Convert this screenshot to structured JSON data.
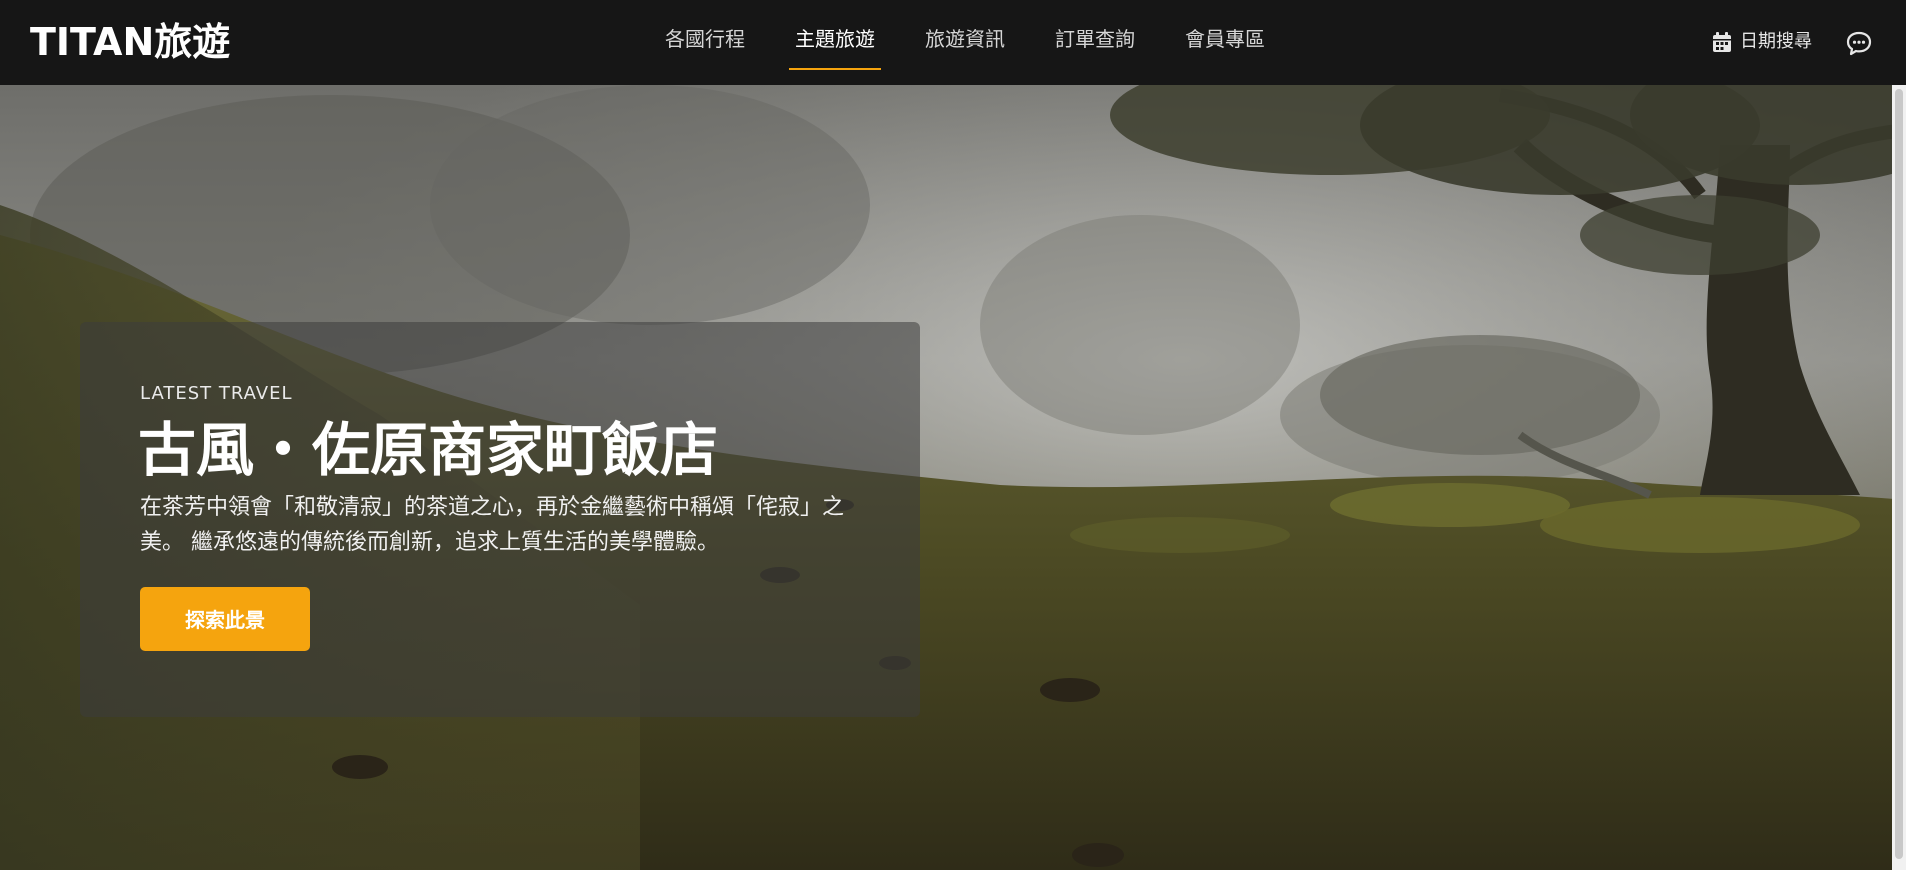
{
  "header": {
    "logo": "TITAN旅遊",
    "nav": [
      {
        "label": "各國行程",
        "active": false
      },
      {
        "label": "主題旅遊",
        "active": true
      },
      {
        "label": "旅遊資訊",
        "active": false
      },
      {
        "label": "訂單查詢",
        "active": false
      },
      {
        "label": "會員專區",
        "active": false
      }
    ],
    "date_search_label": "日期搜尋",
    "date_icon": "calendar-icon",
    "chat_icon": "chat-bubble-icon"
  },
  "hero": {
    "eyebrow": "LATEST TRAVEL",
    "title": "古風・佐原商家町飯店",
    "description": "在茶芳中領會「和敬清寂」的茶道之心，再於金繼藝術中稱頌「侘寂」之美。 繼承悠遠的傳統後而創新，追求上質生活的美學體驗。",
    "cta_label": "探索此景"
  },
  "colors": {
    "header_bg": "#161616",
    "accent": "#f5a40e",
    "card_bg": "rgba(60,60,60,0.55)"
  }
}
